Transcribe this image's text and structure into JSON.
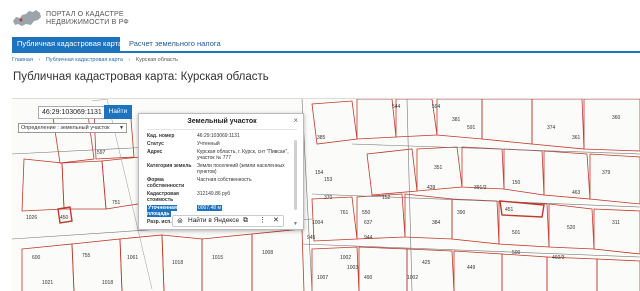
{
  "header": {
    "logo_line1": "ПОРТАЛ О КАДАСТРЕ",
    "logo_line2": "НЕДВИЖИМОСТИ В РФ"
  },
  "tabs": [
    {
      "label": "Публичная кадастровая карта",
      "active": true
    },
    {
      "label": "Расчет земельного налога",
      "active": false
    }
  ],
  "breadcrumb": {
    "home": "Главная",
    "map": "Публичная кадастровая карта",
    "current": "Курская область"
  },
  "page_title": "Публичная кадастровая карта: Курская область",
  "search": {
    "value": "46:29:103069:1131",
    "button": "Найти"
  },
  "select": {
    "value": "Определение : земельный участок"
  },
  "popup": {
    "title": "Земельный участок",
    "close": "×",
    "rows": [
      {
        "key": "Кад. номер",
        "value": "46:29:103069:1131"
      },
      {
        "key": "Статус",
        "value": "Учтенный"
      },
      {
        "key": "Адрес",
        "value": "Курская область, г. Курск, снт \"Пивсан\", участок № 777"
      },
      {
        "key": "Категория земель",
        "value": "Земли поселений (земли населенных пунктов)"
      },
      {
        "key": "Форма собственности",
        "value": "Частная собственность"
      },
      {
        "key": "Кадастровая стоимость",
        "value": "312149.86 руб"
      },
      {
        "key": "Уточненная площадь",
        "value": "0007.48 м"
      },
      {
        "key": "Разр. исп.",
        "value": ""
      }
    ]
  },
  "yandex": {
    "label": "Найти в Яндексе"
  },
  "parcel_numbers": [
    "544",
    "594",
    "381",
    "385",
    "360",
    "591",
    "374",
    "154",
    "351",
    "150",
    "439",
    "391/2",
    "463",
    "451",
    "550",
    "637",
    "597",
    "153",
    "384",
    "390",
    "1026",
    "450",
    "1004",
    "370",
    "152",
    "761",
    "1002",
    "945",
    "944",
    "1003",
    "501",
    "490",
    "1007",
    "425",
    "449",
    "1002",
    "520",
    "500",
    "460/3",
    "751",
    "600",
    "755",
    "1061",
    "1018",
    "1015",
    "1008",
    "1021",
    "1018",
    "361",
    "379",
    "311"
  ]
}
